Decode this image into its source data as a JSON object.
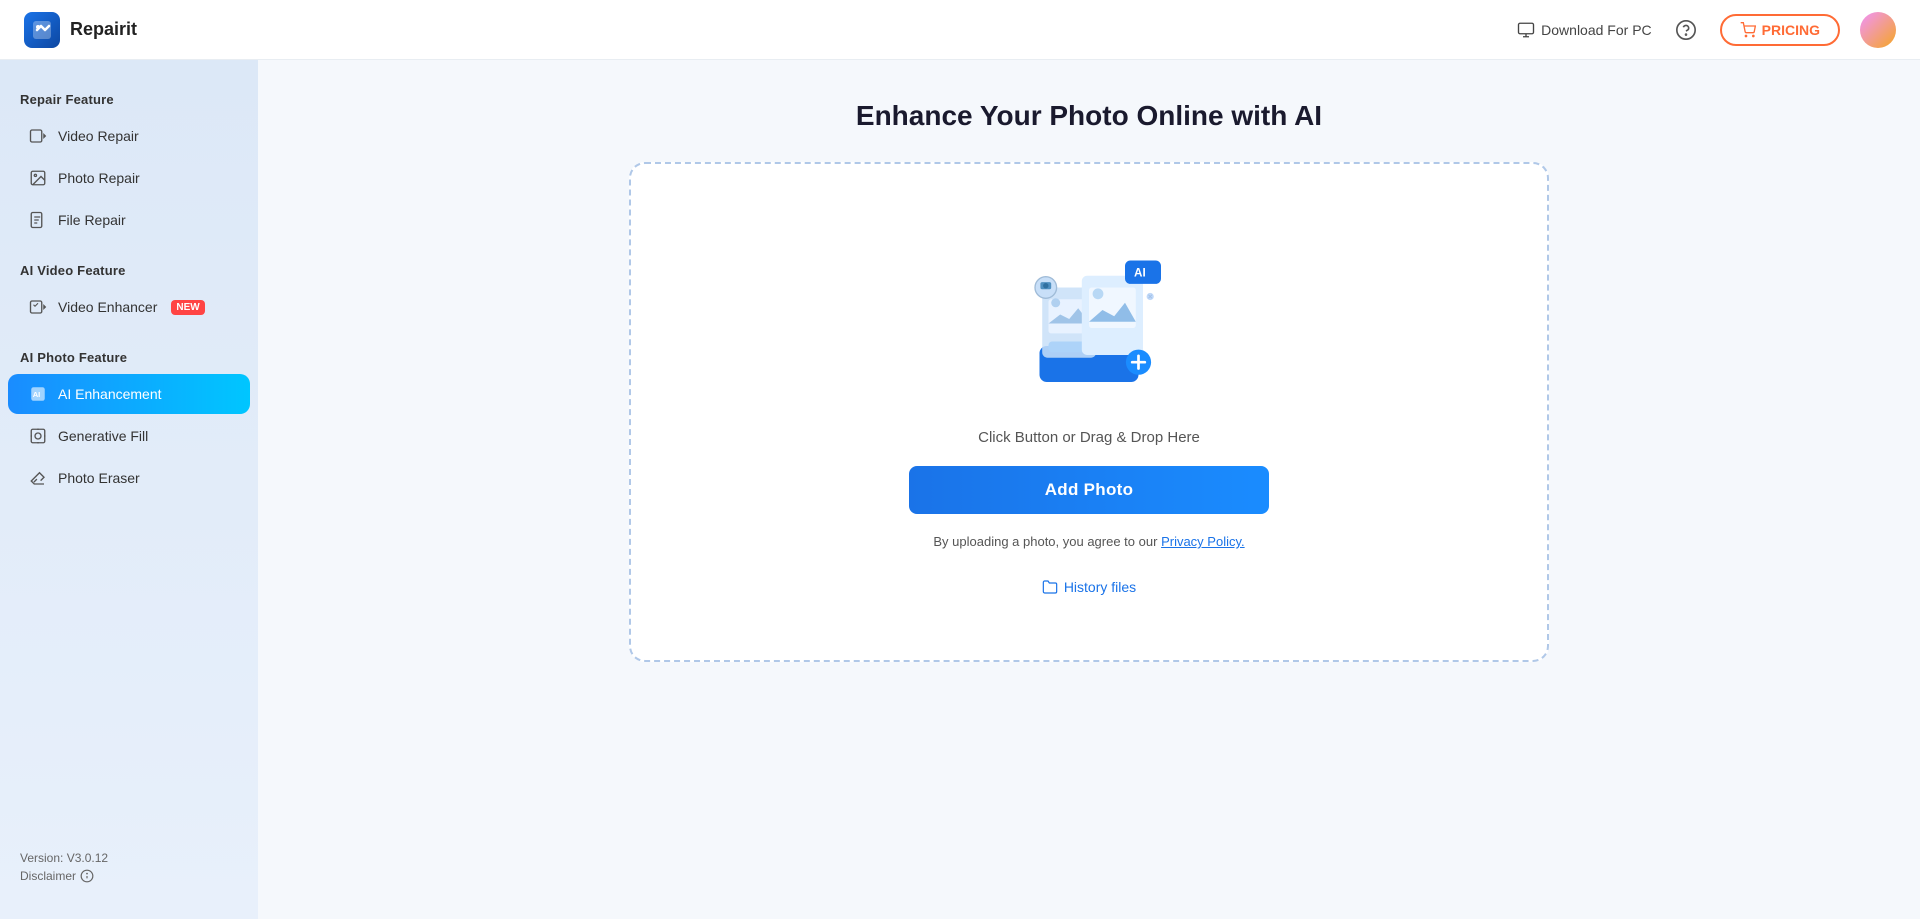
{
  "app": {
    "name": "Repairit"
  },
  "header": {
    "download_label": "Download For PC",
    "pricing_label": "PRICING"
  },
  "sidebar": {
    "repair_feature_label": "Repair Feature",
    "ai_video_feature_label": "AI Video Feature",
    "ai_photo_feature_label": "AI Photo Feature",
    "items": {
      "video_repair": "Video Repair",
      "photo_repair": "Photo Repair",
      "file_repair": "File Repair",
      "video_enhancer": "Video Enhancer",
      "ai_enhancement": "AI Enhancement",
      "generative_fill": "Generative Fill",
      "photo_eraser": "Photo Eraser"
    },
    "new_badge": "NEW",
    "version": "Version: V3.0.12",
    "disclaimer": "Disclaimer"
  },
  "main": {
    "title": "Enhance Your Photo Online with AI",
    "upload_hint": "Click Button or Drag & Drop Here",
    "add_photo_label": "Add Photo",
    "privacy_text": "By uploading a photo, you agree to our",
    "privacy_link": "Privacy Policy.",
    "history_label": "History files"
  }
}
